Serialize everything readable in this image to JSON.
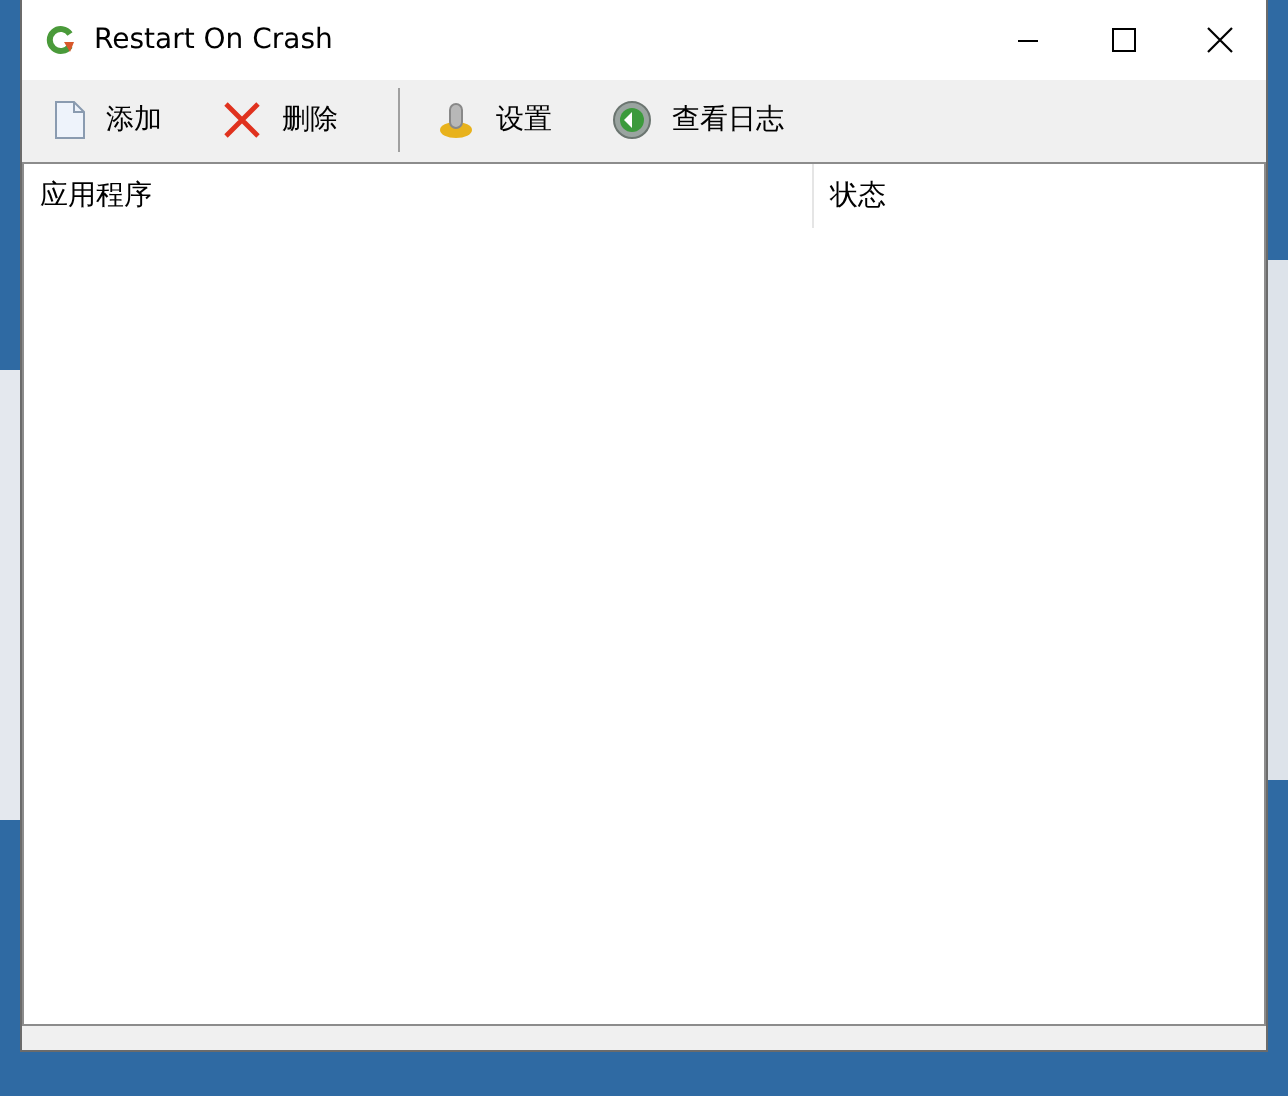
{
  "window": {
    "title": "Restart On Crash"
  },
  "toolbar": {
    "groups": [
      [
        {
          "label": "添加",
          "kind": "add"
        },
        {
          "label": "删除",
          "kind": "delete"
        }
      ],
      [
        {
          "label": "设置",
          "kind": "settings"
        },
        {
          "label": "查看日志",
          "kind": "log"
        }
      ]
    ]
  },
  "list": {
    "columns": [
      {
        "label": "应用程序"
      },
      {
        "label": "状态"
      }
    ]
  }
}
